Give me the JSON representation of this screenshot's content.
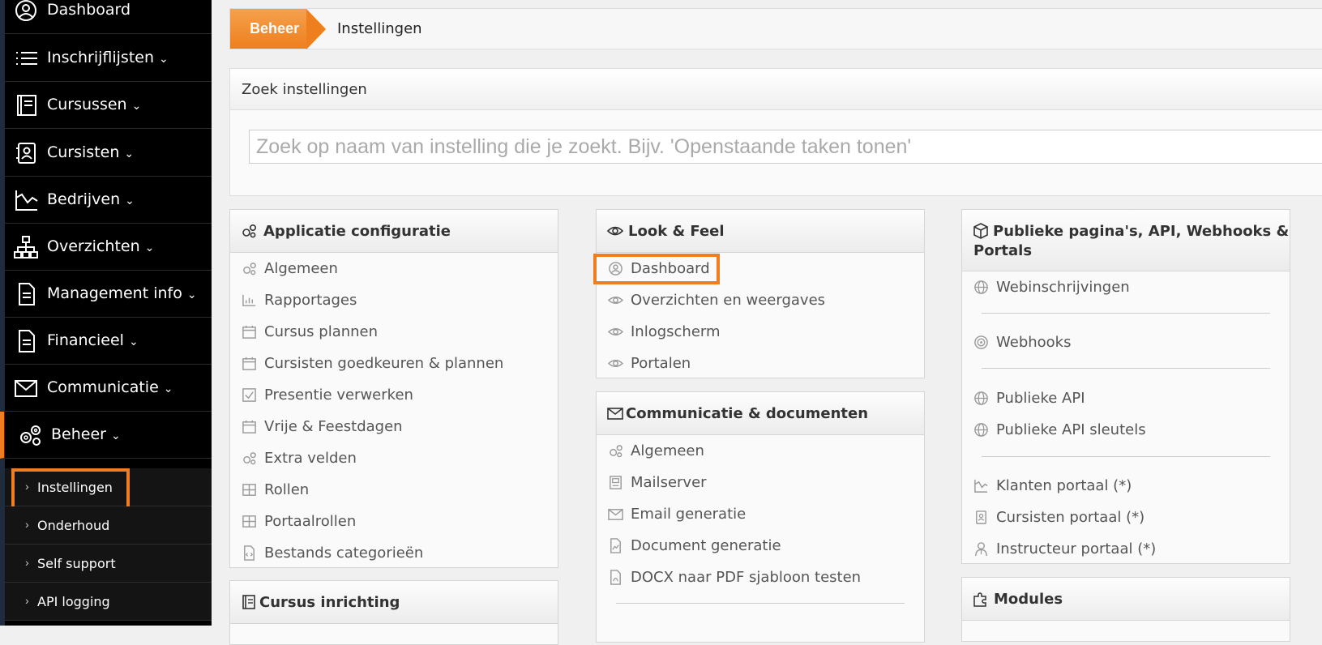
{
  "sidebar": {
    "items": [
      {
        "label": "Dashboard",
        "icon": "user-circle-icon"
      },
      {
        "label": "Inschrijflijsten",
        "icon": "list-icon"
      },
      {
        "label": "Cursussen",
        "icon": "book-icon"
      },
      {
        "label": "Cursisten",
        "icon": "contact-book-icon"
      },
      {
        "label": "Bedrijven",
        "icon": "chart-area-icon"
      },
      {
        "label": "Overzichten",
        "icon": "sitemap-icon"
      },
      {
        "label": "Management info",
        "icon": "document-icon"
      },
      {
        "label": "Financieel",
        "icon": "document-icon"
      },
      {
        "label": "Communicatie",
        "icon": "envelope-icon"
      },
      {
        "label": "Beheer",
        "icon": "gears-icon"
      }
    ],
    "caret": "⌄",
    "chevron": "›",
    "subitems": [
      {
        "label": "Instellingen"
      },
      {
        "label": "Onderhoud"
      },
      {
        "label": "Self support"
      },
      {
        "label": "API logging"
      }
    ]
  },
  "breadcrumb": {
    "parent": "Beheer",
    "current": "Instellingen"
  },
  "search": {
    "title": "Zoek instellingen",
    "placeholder": "Zoek op naam van instelling die je zoekt. Bijv. 'Openstaande taken tonen'"
  },
  "cards": {
    "app": {
      "title": "Applicatie configuratie",
      "items": [
        "Algemeen",
        "Rapportages",
        "Cursus plannen",
        "Cursisten goedkeuren & plannen",
        "Presentie verwerken",
        "Vrije & Feestdagen",
        "Extra velden",
        "Rollen",
        "Portaalrollen",
        "Bestands categorieën"
      ]
    },
    "look": {
      "title": "Look & Feel",
      "items": [
        "Dashboard",
        "Overzichten en weergaves",
        "Inlogscherm",
        "Portalen"
      ]
    },
    "comm": {
      "title": "Communicatie & documenten",
      "items": [
        "Algemeen",
        "Mailserver",
        "Email generatie",
        "Document generatie",
        "DOCX naar PDF sjabloon testen"
      ]
    },
    "pub": {
      "title1": "Publieke pagina's, API, Webhooks &",
      "title2": "Portals",
      "items": [
        "Webinschrijvingen",
        "Webhooks",
        "Publieke API",
        "Publieke API sleutels",
        "Klanten portaal (*)",
        "Cursisten portaal (*)",
        "Instructeur portaal (*)"
      ]
    },
    "cursus": {
      "title": "Cursus inrichting"
    },
    "modules": {
      "title": "Modules"
    }
  },
  "colors": {
    "accent": "#f07d1f",
    "sidebar": "#000000"
  }
}
